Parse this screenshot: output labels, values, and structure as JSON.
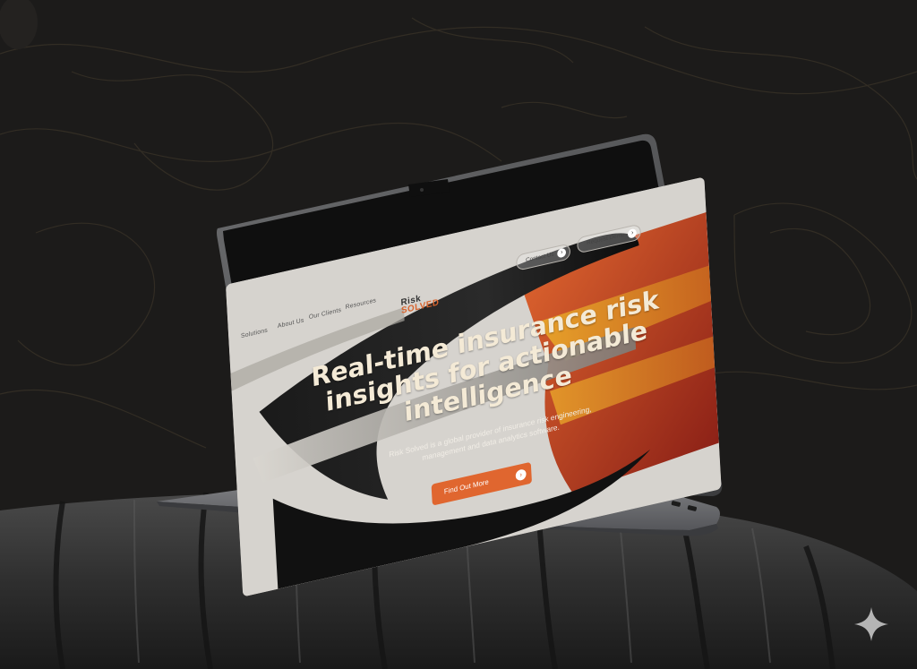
{
  "site": {
    "logo_line1": "Risk",
    "logo_line2": "SOLVED",
    "nav": [
      "Solutions",
      "About Us",
      "Our Clients",
      "Resources"
    ],
    "contact_label": "Contact Us",
    "request_label": "Request Demo",
    "headline": "Real-time insurance risk insights for actionable intelligence",
    "subtitle": "Risk Solved is a global provider of insurance risk engineering, management and data analytics software.",
    "cta_label": "Find Out More",
    "arrow_icon": "arrow-right-icon"
  },
  "colors": {
    "background": "#1c1b1a",
    "accent": "#e0662f",
    "headline": "#f4ead6"
  }
}
